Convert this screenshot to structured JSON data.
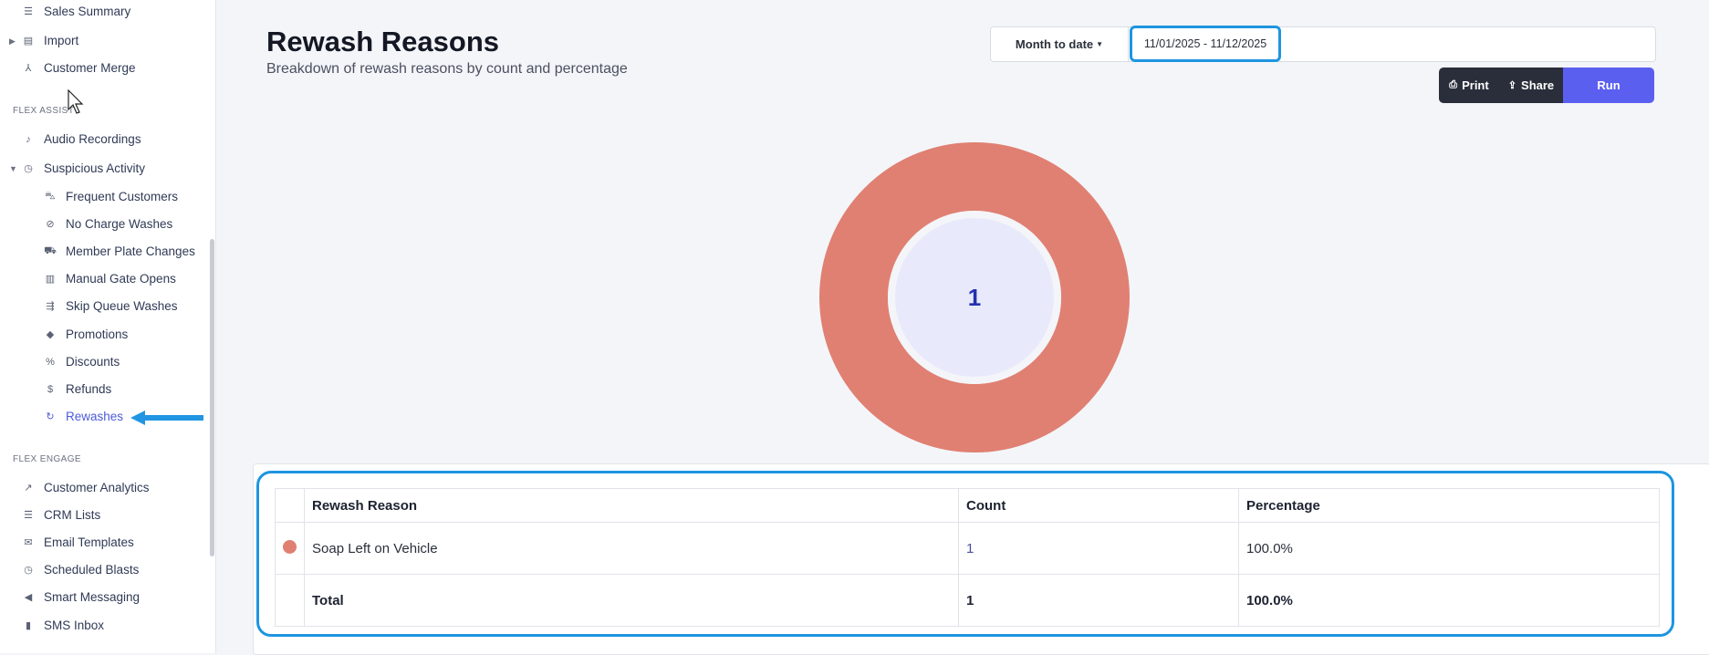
{
  "sidebar": {
    "items_top": [
      {
        "label": "Sales Summary",
        "icon": "list-icon"
      },
      {
        "label": "Import",
        "icon": "file-icon"
      },
      {
        "label": "Customer Merge",
        "icon": "merge-icon"
      }
    ],
    "section_assist": "FLEX ASSIST",
    "items_assist": [
      {
        "label": "Audio Recordings",
        "icon": "music-note-icon"
      },
      {
        "label": "Suspicious Activity",
        "icon": "clock-icon"
      }
    ],
    "suspicious_children": [
      {
        "label": "Frequent Customers",
        "icon": "car-icon"
      },
      {
        "label": "No Charge Washes",
        "icon": "no-charge-icon"
      },
      {
        "label": "Member Plate Changes",
        "icon": "car-swap-icon"
      },
      {
        "label": "Manual Gate Opens",
        "icon": "gate-icon"
      },
      {
        "label": "Skip Queue Washes",
        "icon": "skip-queue-icon"
      },
      {
        "label": "Promotions",
        "icon": "tag-icon"
      },
      {
        "label": "Discounts",
        "icon": "discount-icon"
      },
      {
        "label": "Refunds",
        "icon": "refund-icon"
      },
      {
        "label": "Rewashes",
        "icon": "refresh-icon"
      }
    ],
    "section_engage": "FLEX ENGAGE",
    "items_engage": [
      {
        "label": "Customer Analytics",
        "icon": "trend-icon"
      },
      {
        "label": "CRM Lists",
        "icon": "list-doc-icon"
      },
      {
        "label": "Email Templates",
        "icon": "envelope-icon"
      },
      {
        "label": "Scheduled Blasts",
        "icon": "clock-icon"
      },
      {
        "label": "Smart Messaging",
        "icon": "megaphone-icon"
      },
      {
        "label": "SMS Inbox",
        "icon": "phone-icon"
      }
    ]
  },
  "header": {
    "title": "Rewash Reasons",
    "subtitle": "Breakdown of rewash reasons by count and percentage",
    "range_preset": "Month to date",
    "date_range": "11/01/2025 - 11/12/2025",
    "print_label": "Print",
    "share_label": "Share",
    "run_label": "Run"
  },
  "chart_data": {
    "type": "pie",
    "categories": [
      "Soap Left on Vehicle"
    ],
    "values": [
      1
    ],
    "center_label": "1",
    "colors": [
      "#e08072"
    ]
  },
  "table": {
    "headers": [
      "Rewash Reason",
      "Count",
      "Percentage"
    ],
    "rows": [
      {
        "reason": "Soap Left on Vehicle",
        "count": "1",
        "percentage": "100.0%",
        "color": "#e08072"
      }
    ],
    "total": {
      "label": "Total",
      "count": "1",
      "percentage": "100.0%"
    }
  },
  "colors": {
    "accent": "#5b5ff0",
    "highlight": "#1d95e0",
    "slice": "#e08072"
  }
}
